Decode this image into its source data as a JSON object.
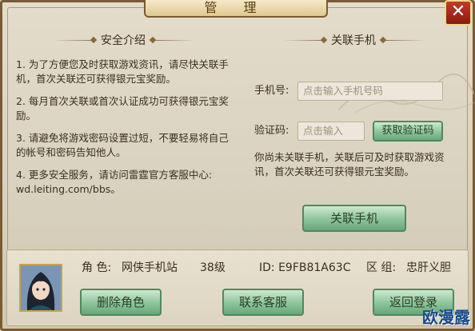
{
  "window": {
    "title": "管 理",
    "close_glyph": "✕"
  },
  "left_section": {
    "header": "安全介绍",
    "paragraphs": [
      "1. 为了方便您及时获取游戏资讯，请尽快关联手机，首次关联还可获得银元宝奖励。",
      "2. 每月首次关联或首次认证成功可获得银元宝奖励。",
      "3. 请避免将游戏密码设置过短，不要轻易将自己的帐号和密码告知他人。",
      "4. 更多安全服务，请访问雷霆官方客服中心: wd.leiting.com/bbs。"
    ]
  },
  "right_section": {
    "header": "关联手机",
    "phone_label": "手机号:",
    "phone_placeholder": "点击输入手机号码",
    "code_label": "验证码:",
    "code_placeholder": "点击输入",
    "get_code_button": "获取验证码",
    "note": "你尚未关联手机，关联后可及时获取游戏资讯，首次关联还可获得银元宝奖励。",
    "bind_button": "关联手机"
  },
  "footer": {
    "role_label": "角 色:",
    "role_name": "网侠手机站",
    "level": "38级",
    "id_text": "ID: E9FB81A63C",
    "zone_label": "区 组:",
    "zone_name": "忠肝义胆",
    "delete_button": "删除角色",
    "support_button": "联系客服",
    "back_button": "返回登录"
  },
  "watermark": "欧漫露"
}
